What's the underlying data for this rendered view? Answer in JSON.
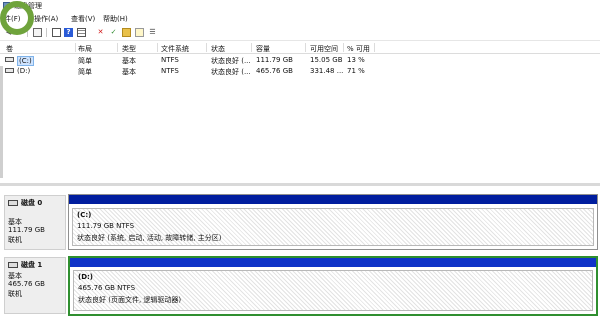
{
  "window": {
    "title": "磁盘管理"
  },
  "menu": [
    {
      "label": "件(F)"
    },
    {
      "label": "操作(A)"
    },
    {
      "label": "查看(V)"
    },
    {
      "label": "帮助(H)"
    }
  ],
  "toolbar": {
    "buttons": [
      {
        "icon": "back-arrow-icon"
      },
      {
        "icon": "forward-arrow-icon"
      },
      {
        "icon": "console-tree-icon"
      },
      {
        "icon": "properties-icon"
      },
      {
        "icon": "help-icon"
      },
      {
        "icon": "grid-view-icon"
      },
      {
        "icon": "delete-icon"
      },
      {
        "icon": "check-icon"
      },
      {
        "icon": "open-folder-icon"
      },
      {
        "icon": "new-document-icon"
      },
      {
        "icon": "refresh-list-icon"
      }
    ]
  },
  "volume_list": {
    "columns": [
      "卷",
      "布局",
      "类型",
      "文件系统",
      "状态",
      "容量",
      "可用空间",
      "% 可用"
    ],
    "rows": [
      {
        "volume": "(C:)",
        "layout": "简单",
        "type": "基本",
        "fs": "NTFS",
        "status": "状态良好 (...",
        "capacity": "111.79 GB",
        "free": "15.05 GB",
        "pct": "13 %"
      },
      {
        "volume": "(D:)",
        "layout": "简单",
        "type": "基本",
        "fs": "NTFS",
        "status": "状态良好 (...",
        "capacity": "465.76 GB",
        "free": "331.48 ...",
        "pct": "71 %"
      }
    ]
  },
  "disks": [
    {
      "name": "磁盘 0",
      "type": "基本",
      "size": "111.79 GB",
      "status": "联机",
      "partition": {
        "label": "(C:)",
        "size_fs": "111.79 GB NTFS",
        "status": "状态良好 (系统, 启动, 活动, 故障转储, 主分区)"
      }
    },
    {
      "name": "磁盘 1",
      "type": "基本",
      "size": "465.76 GB",
      "status": "联机",
      "partition": {
        "label": "(D:)",
        "size_fs": "465.76 GB NTFS",
        "status": "状态良好 (页面文件, 逻辑驱动器)"
      }
    }
  ],
  "colors": {
    "partition_header": "#001d9e",
    "selection_ring": "#6fa33c",
    "selected_partition_border": "#2f8f2f"
  }
}
